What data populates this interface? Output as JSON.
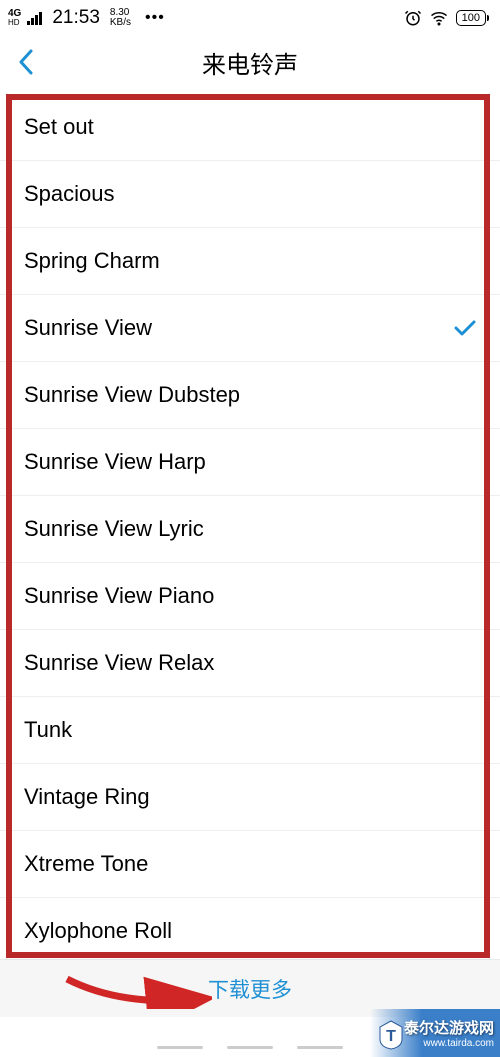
{
  "statusBar": {
    "networkType": "4G",
    "networkSub": "HD",
    "time": "21:53",
    "speedValue": "8.30",
    "speedUnit": "KB/s",
    "battery": "100"
  },
  "header": {
    "title": "来电铃声"
  },
  "ringtones": [
    {
      "label": "Set out",
      "selected": false
    },
    {
      "label": "Spacious",
      "selected": false
    },
    {
      "label": "Spring Charm",
      "selected": false
    },
    {
      "label": "Sunrise View",
      "selected": true
    },
    {
      "label": "Sunrise View Dubstep",
      "selected": false
    },
    {
      "label": "Sunrise View Harp",
      "selected": false
    },
    {
      "label": "Sunrise View Lyric",
      "selected": false
    },
    {
      "label": "Sunrise View Piano",
      "selected": false
    },
    {
      "label": "Sunrise View Relax",
      "selected": false
    },
    {
      "label": "Tunk",
      "selected": false
    },
    {
      "label": "Vintage Ring",
      "selected": false
    },
    {
      "label": "Xtreme Tone",
      "selected": false
    },
    {
      "label": "Xylophone Roll",
      "selected": false
    }
  ],
  "footer": {
    "downloadMore": "下载更多"
  },
  "watermark": {
    "line1": "泰尔达游戏网",
    "line2": "www.tairda.com"
  },
  "colors": {
    "accent": "#1e90d4",
    "highlight": "#b92929"
  }
}
